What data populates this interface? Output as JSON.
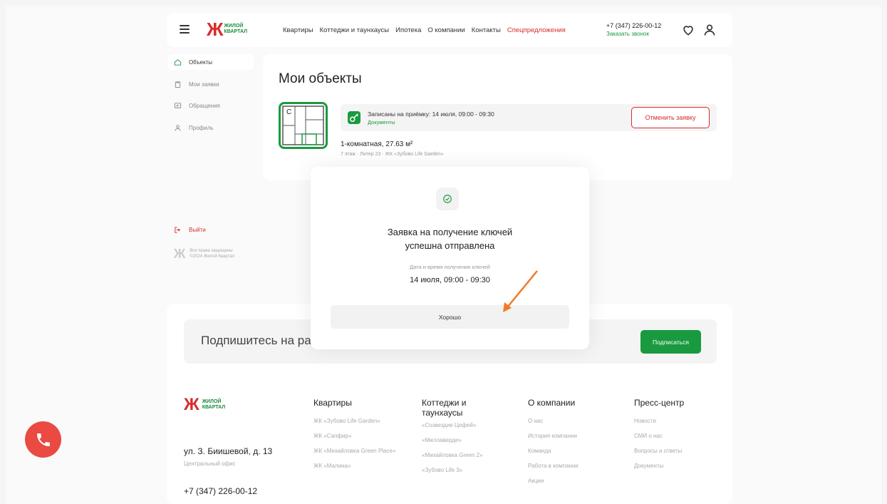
{
  "header": {
    "logo_text_line1": "ЖИЛОЙ",
    "logo_text_line2": "КВАРТАЛ",
    "nav": [
      "Квартиры",
      "Коттеджи и таунхаусы",
      "Ипотека",
      "О компании",
      "Контакты",
      "Спецпредложения"
    ],
    "phone": "+7 (347) 226-00-12",
    "callback": "Заказать звонок"
  },
  "sidebar": {
    "items": [
      {
        "label": "Объекты",
        "icon": "home-icon"
      },
      {
        "label": "Мои заявки",
        "icon": "clipboard-icon"
      },
      {
        "label": "Обращения",
        "icon": "message-icon"
      },
      {
        "label": "Профиль",
        "icon": "user-icon"
      }
    ],
    "logout": "Выйти",
    "copyright_line1": "Все права защищены",
    "copyright_line2": "©2024 Жилой Квартал"
  },
  "main": {
    "title": "Мои объекты",
    "status_text": "Записаны на приёмку: 14 июля, 09:00 - 09:30",
    "documents": "Документы",
    "cancel": "Отменить заявку",
    "flat_title": "1-комнатная, 27.63 м²",
    "flat_sub": "7 этаж · Литер 23 · ЖК «Зубово Life Garden»"
  },
  "modal": {
    "title_line1": "Заявка на получение ключей",
    "title_line2": "успешна отправлена",
    "date_label": "Дата и время получения ключей",
    "date_value": "14 июля, 09:00 - 09:30",
    "ok": "Хорошо"
  },
  "footer": {
    "subscribe_label": "Подпишитесь на рассы",
    "subscribe_button": "Подписаться",
    "address": "ул. З. Биишевой, д. 13",
    "office": "Центральный офис",
    "phone": "+7 (347) 226-00-12",
    "columns": [
      {
        "title": "Квартиры",
        "items": [
          "ЖК «Зубово Life Garden»",
          "ЖК «Сапфир»",
          "ЖК «Михайловка Green Place»",
          "ЖК «Малина»"
        ]
      },
      {
        "title": "Коттеджи и таунхаусы",
        "items": [
          "«Созвездие Цефей»",
          "«Миллаверде»",
          "«Михайловка Green 2»",
          "«Зубово Life 3»"
        ]
      },
      {
        "title": "О компании",
        "items": [
          "О нас",
          "История компании",
          "Команда",
          "Работа в компании",
          "Акции"
        ]
      },
      {
        "title": "Пресс-центр",
        "items": [
          "Новости",
          "СМИ о нас",
          "Вопросы и ответы",
          "Документы"
        ]
      }
    ]
  },
  "colors": {
    "brand_green": "#1a9a40",
    "brand_red": "#d82c2c",
    "call_fab": "#ea4a42",
    "arrow": "#f07a2a"
  }
}
